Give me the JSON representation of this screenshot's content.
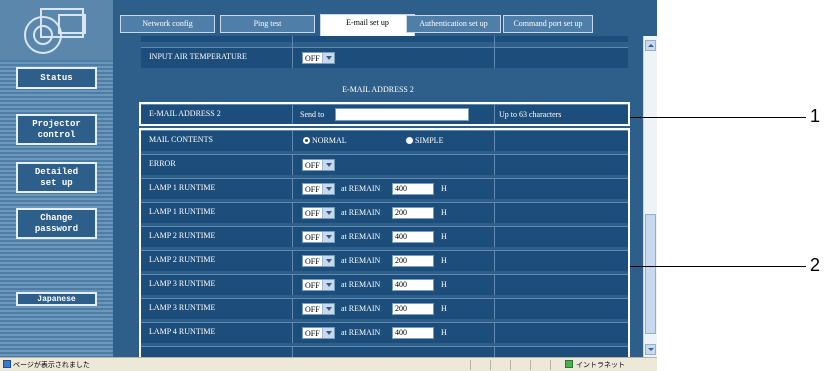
{
  "sidebar": {
    "buttons": [
      "Status",
      "Projector\ncontrol",
      "Detailed\nset up",
      "Change\npassword"
    ],
    "language_button": "Japanese"
  },
  "tabs": [
    "Network config",
    "Ping test",
    "E-mail set up",
    "Authentication set up",
    "Command port set up"
  ],
  "form": {
    "input_air_label": "INPUT AIR TEMPERATURE",
    "input_air_value": "OFF",
    "section_title": "E-MAIL ADDRESS 2",
    "email_label": "E-MAIL ADDRESS 2",
    "send_to_label": "Send to",
    "email_value": "",
    "email_hint": "Up to 63 characters",
    "mail_contents_label": "MAIL CONTENTS",
    "mail_option_normal": "NORMAL",
    "mail_option_simple": "SIMPLE",
    "error_label": "ERROR",
    "error_value": "OFF",
    "remain_label": "at REMAIN",
    "hours_unit": "H",
    "lamp_rows": [
      {
        "label": "LAMP 1 RUNTIME",
        "state": "OFF",
        "remain": "400"
      },
      {
        "label": "LAMP 1 RUNTIME",
        "state": "OFF",
        "remain": "200"
      },
      {
        "label": "LAMP 2 RUNTIME",
        "state": "OFF",
        "remain": "400"
      },
      {
        "label": "LAMP 2 RUNTIME",
        "state": "OFF",
        "remain": "200"
      },
      {
        "label": "LAMP 3 RUNTIME",
        "state": "OFF",
        "remain": "400"
      },
      {
        "label": "LAMP 3 RUNTIME",
        "state": "OFF",
        "remain": "200"
      },
      {
        "label": "LAMP 4 RUNTIME",
        "state": "OFF",
        "remain": "400"
      }
    ]
  },
  "statusbar": {
    "status_text": "ページが表示されました",
    "zone_text": "イントラネット"
  },
  "callouts": {
    "one": "1",
    "two": "2"
  }
}
